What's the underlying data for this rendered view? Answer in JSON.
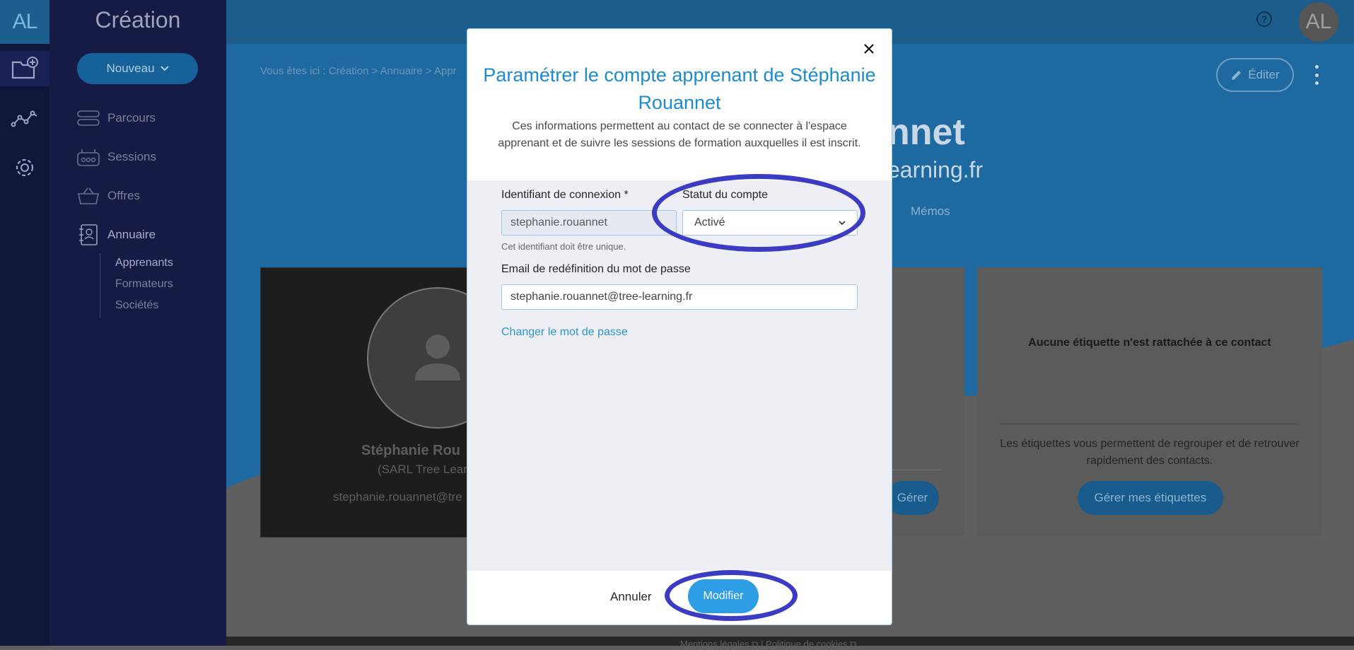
{
  "rail": {
    "logo": "AL"
  },
  "sidebar": {
    "title": "Création",
    "new_button": "Nouveau",
    "items": [
      {
        "label": "Parcours"
      },
      {
        "label": "Sessions"
      },
      {
        "label": "Offres"
      },
      {
        "label": "Annuaire"
      }
    ],
    "subitems": [
      {
        "label": "Apprenants"
      },
      {
        "label": "Formateurs"
      },
      {
        "label": "Sociétés"
      }
    ]
  },
  "header": {
    "help": "?",
    "avatar": "AL"
  },
  "page": {
    "breadcrumb": "Vous êtes ici : Création > Annuaire > Appr",
    "edit_button": "Éditer",
    "contact_name_partial": "nnet",
    "contact_email_partial": "earning.fr",
    "tab_memos": "Mémos"
  },
  "profile_card": {
    "name": "Stéphanie Rou",
    "company": "(SARL Tree Lear",
    "email": "stephanie.rouannet@tre"
  },
  "mid_card": {
    "button": "Gérer"
  },
  "tags_card": {
    "empty_text": "Aucune étiquette n'est rattachée à ce contact",
    "description": "Les étiquettes vous permettent de regrouper et de retrouver rapidement des contacts.",
    "button": "Gérer mes étiquettes"
  },
  "footer": {
    "links": "Mentions légales ⧉ | Politique de cookies ⧉"
  },
  "modal": {
    "title": "Paramétrer le compte apprenant de Stéphanie Rouannet",
    "description": "Ces informations permettent au contact de se connecter à l'espace apprenant et de suivre les sessions de formation auxquelles il est inscrit.",
    "login_label": "Identifiant de connexion *",
    "login_value": "stephanie.rouannet",
    "login_help": "Cet identifiant doit être unique.",
    "status_label": "Statut du compte",
    "status_value": "Activé",
    "email_label": "Email de redéfinition du mot de passe",
    "email_value": "stephanie.rouannet@tree-learning.fr",
    "change_password": "Changer le mot de passe",
    "cancel": "Annuler",
    "submit": "Modifier"
  },
  "colors": {
    "accent": "#2d9ee6",
    "title_blue": "#1c8bd2",
    "annotation": "#3c3bc3",
    "sidebar_bg": "#161b45"
  }
}
